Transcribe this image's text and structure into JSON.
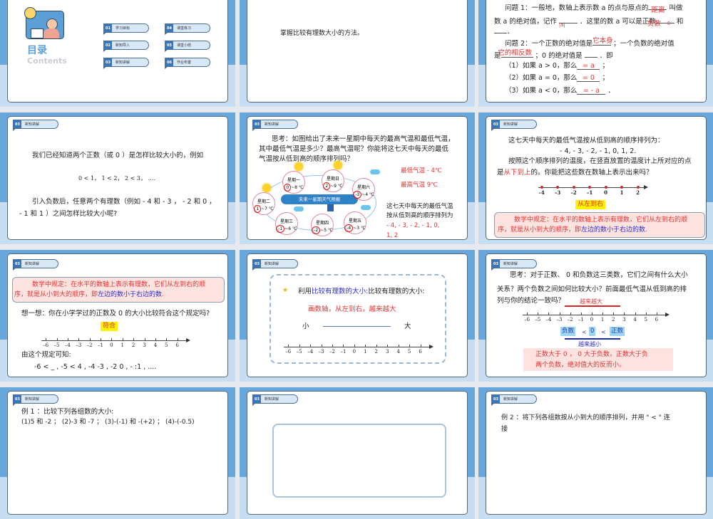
{
  "common": {
    "tag_num": "03",
    "tag_label": "新知讲解"
  },
  "s1": {
    "title": "目录",
    "subtitle": "Contents",
    "items": [
      {
        "num": "01",
        "label": "学习目标"
      },
      {
        "num": "02",
        "label": "新知导入"
      },
      {
        "num": "03",
        "label": "新知讲解"
      },
      {
        "num": "04",
        "label": "课堂练习"
      },
      {
        "num": "05",
        "label": "课堂小结"
      },
      {
        "num": "06",
        "label": "作业布置"
      }
    ]
  },
  "s2": {
    "objective": "掌握比较有理数大小的方法。"
  },
  "s3": {
    "q1a": "问题 1：一般地，数轴上表示数 a 的点与原点的",
    "q1_ans": "距离",
    "q1b": "叫做",
    "l2a": "数 a 的绝对值，记作",
    "abs_ans": "|a|",
    "l2b": "．这里的数 a 可以是正数",
    "neg_ans": "负数",
    "zero_ans": "0",
    "l2c": "和",
    "l3": "．",
    "q2a": "问题 2：一个正数的绝对值是",
    "self_ans": "它本身",
    "q2b": "；一个负数的绝对值",
    "l5a": "是",
    "opp_ans": "它的相反数",
    "l5b": "；0 的绝对值是",
    "l5c": "．即",
    "cases": [
      {
        "pre": "（1）如果 a > 0，那么",
        "ans": "= a",
        "post": "；"
      },
      {
        "pre": "（2）如果 a = 0，那么",
        "ans": "= 0",
        "post": "；"
      },
      {
        "pre": "（3）如果 a < 0，那么",
        "ans": "= - a",
        "post": "．"
      }
    ]
  },
  "s4": {
    "l1": "我们已经知道两个正数（或 0 ）是怎样比较大小的，例如",
    "l2": "0 < 1， 1 < 2， 2 < 3， ….",
    "l3": "引入负数后，任意两个有理数（例如 - 4 和 - 3 ， - 2 和 0 ，",
    "l4": "- 1 和 1 ）之间怎样比较大小呢?"
  },
  "s5": {
    "l1": "思考：如图给出了未来一星期中每天的最高气温和最低气温，",
    "l2": "其中最低气温是多少？最高气温呢？你能将这七天中每天的最低",
    "l3": "气温按从低到高的顺序排列吗？",
    "banner": "未来一星期天气预报",
    "days": [
      {
        "name": "星期一",
        "lo": "0",
        "hi": "~8 ℃"
      },
      {
        "name": "星期日",
        "lo": "2",
        "hi": "~9 ℃"
      },
      {
        "name": "星期六",
        "lo": "-3",
        "hi": "~4 ℃"
      },
      {
        "name": "星期二",
        "lo": "1",
        "hi": "~7 ℃"
      },
      {
        "name": "星期三",
        "lo": "-1",
        "hi": "~6 ℃"
      },
      {
        "name": "星期四",
        "lo": "-2",
        "hi": "~5 ℃"
      },
      {
        "name": "星期五",
        "lo": "-4",
        "hi": "~3 ℃"
      }
    ],
    "min_label": "最低气温 - 4℃",
    "max_label": "最高气温 9℃",
    "r1": "这七天中每天的最低气温",
    "r2": "按从低到高的顺序排列为",
    "r3": "- 4, - 3, - 2, - 1, 0,",
    "r4": "1, 2"
  },
  "s6": {
    "l1": "这七天中每天的最低气温按从低到高的顺序排列为：",
    "l2": "- 4, - 3, - 2, - 1, 0, 1, 2.",
    "l3": "按照这个顺序排列的温度，在竖直放置的温度计上所对应的点",
    "l4a": "是",
    "l4red": "从下到上",
    "l4b": "的。你能把这些数在数轴上表示出来吗？",
    "axis": {
      "min": -4,
      "max": 2,
      "dots": true,
      "labels": [
        "–4",
        "–3",
        "–2",
        "–1",
        "0",
        "1",
        "2"
      ]
    },
    "hl": "从左到右",
    "rule_a": "数学中规定：在水平的数轴上表示有理数，它们从左到右的顺",
    "rule_b": "序，就是从小到大的顺序，即",
    "rule_blue": "左边的数小于右边的数",
    "rule_c": "."
  },
  "s7": {
    "rule_a": "数学中规定：在水平的数轴上表示有理数，它们从左到右的顺",
    "rule_b": "序，就是从小到大的顺序，即",
    "rule_blue": "左边的数小于右边的数",
    "rule_c": ".",
    "q": "想一想：你在小学学过的正数及 0 的大小比较符合这个规定吗?",
    "hl": "符合",
    "axis": {
      "min": -6,
      "max": 6,
      "labels": [
        "–6",
        "–5",
        "–4",
        "–3",
        "–2",
        "–1",
        "0",
        "1",
        "2",
        "3",
        "4",
        "5",
        "6"
      ]
    },
    "l1": "由这个规定可知:",
    "l2": "-6 <  _ ,  -5 <  4 ,  -4    -3 ,  -2    0 ,  -  :1 , ...."
  },
  "s8": {
    "t_a": "利用",
    "t_blue": "数轴",
    "t_b": "比较有理数的大小:",
    "red": "画数轴，从左到右，越来越大",
    "small": "小",
    "big": "大",
    "axis": {
      "min": -6,
      "max": 6,
      "labels": [
        "–6",
        "–5",
        "–4",
        "–3",
        "–2",
        "–1",
        "0",
        "1",
        "2",
        "3",
        "4",
        "5",
        "6"
      ]
    }
  },
  "s9": {
    "l1": "思考：对于正数、 0 和负数这三类数，它们之间有什么大小",
    "l2": "关系？两个负数之间如何比较大小？前面最低气温从低到高的排",
    "l3": "列与你的结论一致吗？",
    "bigger": "越来越大",
    "smaller": "越来越小",
    "axis": {
      "min": -6,
      "max": 6,
      "labels": [
        "–6",
        "–5",
        "–4",
        "–3",
        "–2",
        "–1",
        "0",
        "1",
        "2",
        "3",
        "4",
        "5",
        "6"
      ]
    },
    "neg": "负数",
    "lt": "<",
    "zero": "0",
    "pos": "正数",
    "c1": "正数大于 0 ， 0 大于负数，正数大于负",
    "c2": "两个负数，绝对值大的反而小。"
  },
  "s10": {
    "l1": "例 1 ：比较下列各组数的大小:",
    "l2": "(1)5 和 -2 ； (2)-3 和 -7 ； (3)-(-1) 和 -(+2) ； (4)-(-0.5)"
  },
  "s12": {
    "l1": "例 2 ：将下列各组数按从小到大的顺序排列，并用 \" < \" 连",
    "l2": "接"
  }
}
